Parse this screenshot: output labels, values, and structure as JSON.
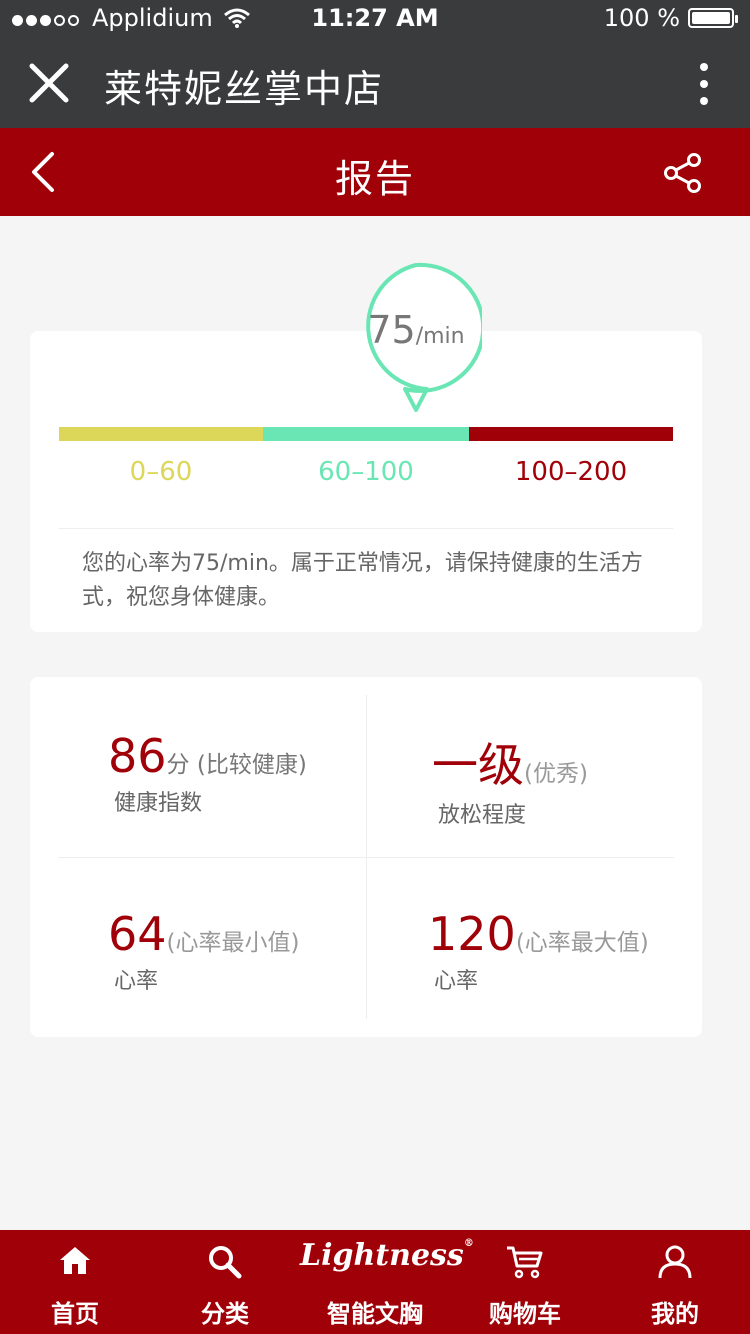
{
  "status_bar": {
    "carrier": "Applidium",
    "time": "11:27 AM",
    "battery": "100 %",
    "battery_level": 1.0
  },
  "app_bar": {
    "title": "莱特妮丝掌中店",
    "close_icon": "close-icon",
    "more_icon": "more-vertical-icon"
  },
  "header": {
    "title": "报告",
    "back_icon": "chevron-left-icon",
    "share_icon": "share-icon"
  },
  "result": {
    "value": "75",
    "unit": "/min",
    "ranges": [
      "0–60",
      "60–100",
      "100–200"
    ],
    "range_colors": [
      "#dcd759",
      "#69e6b4",
      "#a00008"
    ],
    "description": "您的心率为75/min。属于正常情况，请保持健康的生活方式，祝您身体健康。"
  },
  "stats": [
    {
      "value": "86",
      "note": "分 (比较健康)",
      "label": "健康指数"
    },
    {
      "value": "一级",
      "note": "(优秀)",
      "label": "放松程度"
    },
    {
      "value": "64",
      "note": "(心率最小值)",
      "label": "心率"
    },
    {
      "value": "120",
      "note": "(心率最大值)",
      "label": "心率"
    }
  ],
  "tabbar": {
    "items": [
      {
        "label": "首页",
        "icon": "home-icon"
      },
      {
        "label": "分类",
        "icon": "search-icon"
      },
      {
        "label": "智能文胸",
        "icon": "brand-logo",
        "brand": "Lightness"
      },
      {
        "label": "购物车",
        "icon": "cart-icon"
      },
      {
        "label": "我的",
        "icon": "user-icon"
      }
    ]
  },
  "colors": {
    "brand_red": "#a00008",
    "dark_bar": "#3a3b3d",
    "accent_green": "#69e6b4",
    "accent_yellow": "#dcd759"
  }
}
